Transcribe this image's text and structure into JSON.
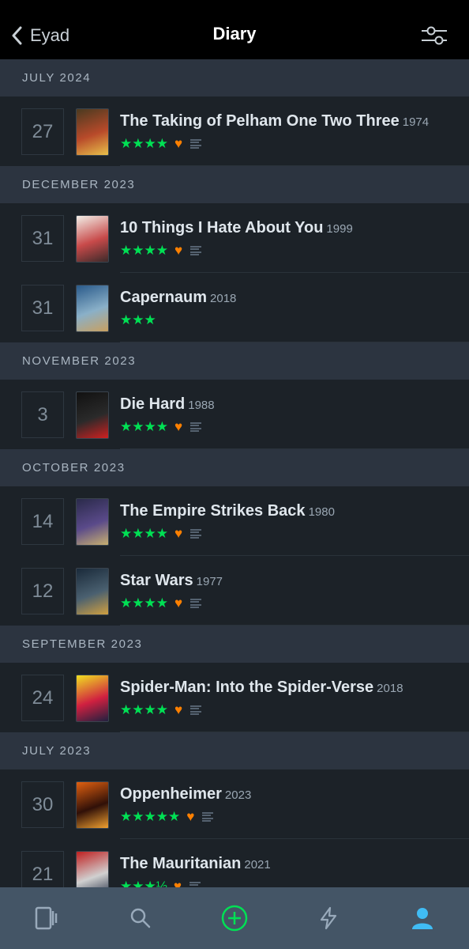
{
  "header": {
    "back_label": "Eyad",
    "title": "Diary"
  },
  "sections": [
    {
      "month": "JULY 2024",
      "entries": [
        {
          "day": "27",
          "title": "The Taking of Pelham One Two Three",
          "year": "1974",
          "stars": "★★★★",
          "liked": true,
          "review": true,
          "poster": [
            "#4a3a20",
            "#b84a2a",
            "#e8c04a"
          ]
        }
      ]
    },
    {
      "month": "DECEMBER 2023",
      "entries": [
        {
          "day": "31",
          "title": "10 Things I Hate About You",
          "year": "1999",
          "stars": "★★★★",
          "liked": true,
          "review": true,
          "poster": [
            "#f2efe8",
            "#c84a4a",
            "#3b2a2a"
          ]
        },
        {
          "day": "31",
          "title": "Capernaum",
          "year": "2018",
          "stars": "★★★",
          "liked": false,
          "review": false,
          "poster": [
            "#2a5a8a",
            "#8ab0c8",
            "#c9a060"
          ]
        }
      ]
    },
    {
      "month": "NOVEMBER 2023",
      "entries": [
        {
          "day": "3",
          "title": "Die Hard",
          "year": "1988",
          "stars": "★★★★",
          "liked": true,
          "review": true,
          "poster": [
            "#111111",
            "#2a2a2a",
            "#d02020"
          ]
        }
      ]
    },
    {
      "month": "OCTOBER 2023",
      "entries": [
        {
          "day": "14",
          "title": "The Empire Strikes Back",
          "year": "1980",
          "stars": "★★★★",
          "liked": true,
          "review": true,
          "poster": [
            "#2a2a4a",
            "#5a4a8a",
            "#c8b070"
          ]
        },
        {
          "day": "12",
          "title": "Star Wars",
          "year": "1977",
          "stars": "★★★★",
          "liked": true,
          "review": true,
          "poster": [
            "#1a2a3a",
            "#4a6070",
            "#d0a040"
          ]
        }
      ]
    },
    {
      "month": "SEPTEMBER 2023",
      "entries": [
        {
          "day": "24",
          "title": "Spider-Man: Into the Spider-Verse",
          "year": "2018",
          "stars": "★★★★",
          "liked": true,
          "review": true,
          "poster": [
            "#f0e020",
            "#d02040",
            "#202040"
          ]
        }
      ]
    },
    {
      "month": "JULY 2023",
      "entries": [
        {
          "day": "30",
          "title": "Oppenheimer",
          "year": "2023",
          "stars": "★★★★★",
          "liked": true,
          "review": true,
          "poster": [
            "#e06010",
            "#301008",
            "#f0a030"
          ]
        },
        {
          "day": "21",
          "title": "The Mauritanian",
          "year": "2021",
          "stars": "★★★½",
          "liked": true,
          "review": true,
          "poster": [
            "#c02020",
            "#d0d0d0",
            "#202a40"
          ]
        }
      ]
    }
  ],
  "tabbar": {
    "items": [
      {
        "name": "films-tab",
        "icon": "films-icon"
      },
      {
        "name": "search-tab",
        "icon": "search-icon"
      },
      {
        "name": "add-tab",
        "icon": "add-icon"
      },
      {
        "name": "activity-tab",
        "icon": "lightning-icon"
      },
      {
        "name": "profile-tab",
        "icon": "profile-icon",
        "active": true
      }
    ]
  },
  "colors": {
    "star": "#00e054",
    "heart": "#ff8000",
    "active_tab": "#40bcf4",
    "add": "#00e054"
  }
}
